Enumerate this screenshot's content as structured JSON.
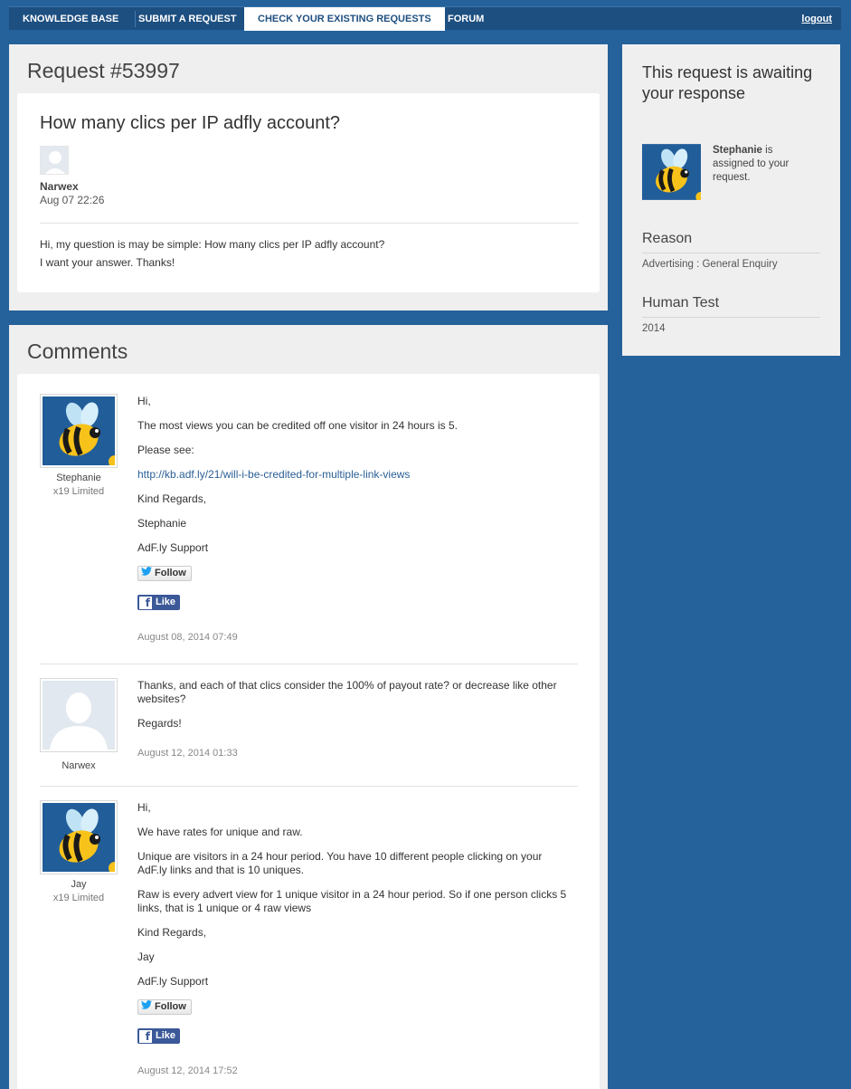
{
  "nav": {
    "items": [
      "KNOWLEDGE BASE",
      "SUBMIT A REQUEST",
      "CHECK YOUR EXISTING REQUESTS",
      "FORUM"
    ],
    "logout": "logout"
  },
  "request": {
    "title": "Request #53997",
    "subject": "How many clics per IP adfly account?",
    "author": "Narwex",
    "date": "Aug 07 22:26",
    "body": [
      "Hi, my question is may be simple: How many clics per IP adfly account?",
      "I want your answer. Thanks!"
    ]
  },
  "comments_title": "Comments",
  "comments": [
    {
      "name": "Stephanie",
      "org": "x19 Limited",
      "lines": [
        "Hi,",
        "The most views you can be credited off one visitor in 24 hours is 5.",
        "Please see:",
        "http://kb.adf.ly/21/will-i-be-credited-for-multiple-link-views",
        "Kind Regards,",
        "Stephanie",
        "AdF.ly Support"
      ],
      "follow": "Follow",
      "like": "Like",
      "date": "August 08, 2014 07:49"
    },
    {
      "name": "Narwex",
      "lines": [
        "Thanks, and each of that clics consider the 100% of payout rate? or decrease like other websites?",
        "Regards!"
      ],
      "date": "August 12, 2014 01:33"
    },
    {
      "name": "Jay",
      "org": "x19 Limited",
      "lines": [
        "Hi,",
        "We have rates for unique and raw.",
        "Unique are visitors in a 24 hour period. You have 10 different people clicking on your AdF.ly links and that is 10 uniques.",
        "Raw is every advert view for 1 unique visitor in a 24 hour period. So if one person clicks 5 links, that is 1 unique or 4 raw views",
        "Kind Regards,",
        "Jay",
        "AdF.ly Support"
      ],
      "follow": "Follow",
      "like": "Like",
      "date": "August 12, 2014 17:52"
    }
  ],
  "sidebar": {
    "status": "This request is awaiting your response",
    "assignee": "Stephanie",
    "assign_text": "is assigned to your request.",
    "reason_label": "Reason",
    "reason_value": "Advertising : General Enquiry",
    "human_label": "Human Test",
    "human_value": "2014"
  },
  "colors": {
    "background": "#25619a",
    "nav": "#1d4f80",
    "panel": "#efefef",
    "link": "#2a5f95",
    "facebook": "#3b5998"
  }
}
